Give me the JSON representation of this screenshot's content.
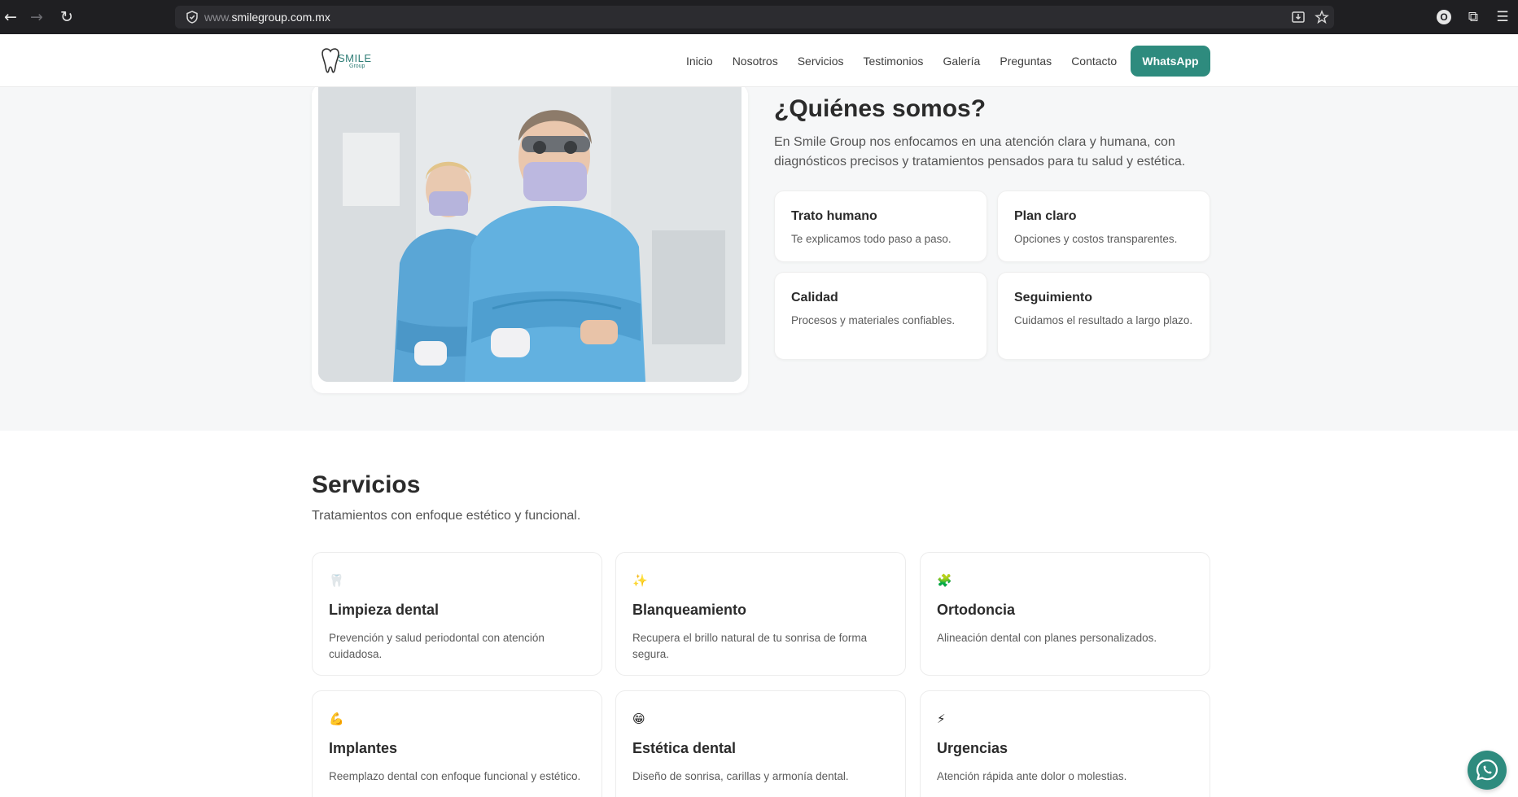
{
  "browser": {
    "back_icon": "←",
    "forward_icon": "→",
    "reload_icon": "↻",
    "url_prefix": "www.",
    "url_domain": "smilegroup.com.mx",
    "menu_icon": "☰",
    "ext_icon": "⧉",
    "profile_letter": "O"
  },
  "header": {
    "logo_text": "SMILE",
    "logo_sub": "Group",
    "nav": [
      "Inicio",
      "Nosotros",
      "Servicios",
      "Testimonios",
      "Galería",
      "Preguntas",
      "Contacto"
    ],
    "cta": "WhatsApp"
  },
  "about": {
    "title": "¿Quiénes somos?",
    "text": "En Smile Group nos enfocamos en una atención clara y humana, con diagnósticos precisos y tratamientos pensados para tu salud y estética.",
    "features": [
      {
        "title": "Trato humano",
        "desc": "Te explicamos todo paso a paso."
      },
      {
        "title": "Plan claro",
        "desc": "Opciones y costos transparentes."
      },
      {
        "title": "Calidad",
        "desc": "Procesos y materiales confiables."
      },
      {
        "title": "Seguimiento",
        "desc": "Cuidamos el resultado a largo plazo."
      }
    ]
  },
  "services": {
    "title": "Servicios",
    "subtitle": "Tratamientos con enfoque estético y funcional.",
    "items": [
      {
        "icon": "🦷",
        "icon_name": "tooth-icon",
        "title": "Limpieza dental",
        "desc": "Prevención y salud periodontal con atención cuidadosa."
      },
      {
        "icon": "✨",
        "icon_name": "sparkles-icon",
        "title": "Blanqueamiento",
        "desc": "Recupera el brillo natural de tu sonrisa de forma segura."
      },
      {
        "icon": "🧩",
        "icon_name": "puzzle-icon",
        "title": "Ortodoncia",
        "desc": "Alineación dental con planes personalizados."
      },
      {
        "icon": "💪",
        "icon_name": "strength-icon",
        "title": "Implantes",
        "desc": "Reemplazo dental con enfoque funcional y estético."
      },
      {
        "icon": "😁",
        "icon_name": "smile-icon",
        "title": "Estética dental",
        "desc": "Diseño de sonrisa, carillas y armonía dental."
      },
      {
        "icon": "⚡",
        "icon_name": "lightning-icon",
        "title": "Urgencias",
        "desc": "Atención rápida ante dolor o molestias."
      }
    ]
  },
  "colors": {
    "accent": "#2e8b7e",
    "section_bg": "#f6f7f8",
    "chrome_bg": "#1f1f22"
  }
}
